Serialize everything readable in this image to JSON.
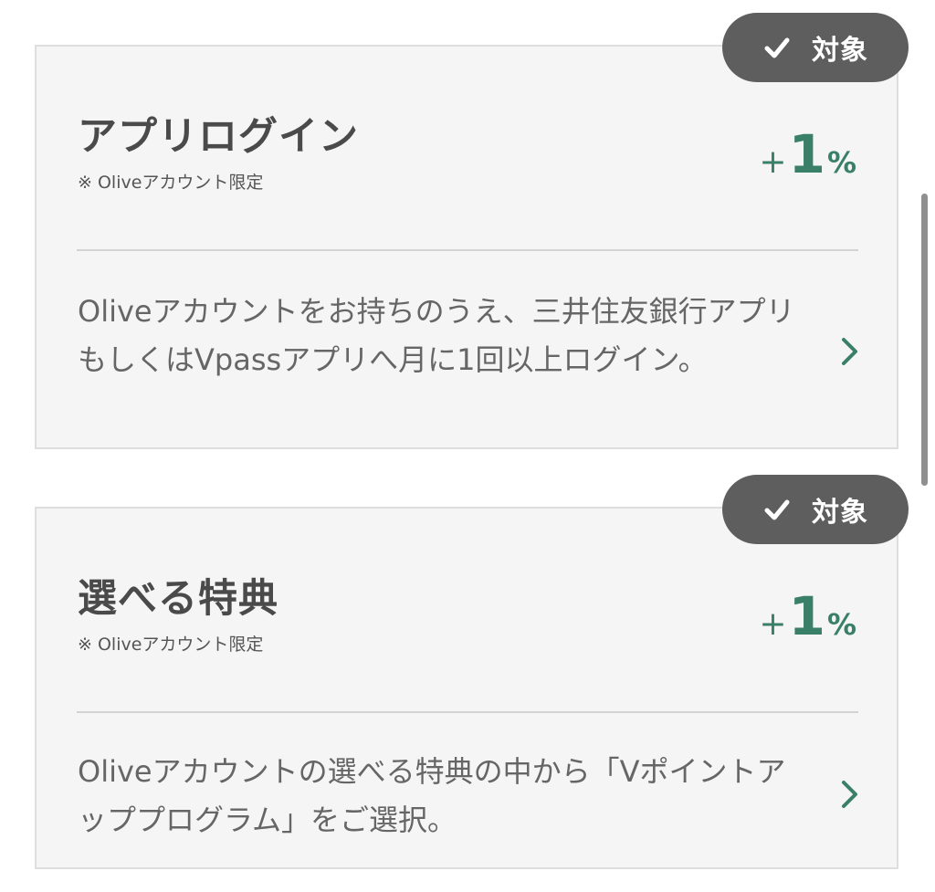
{
  "cards": [
    {
      "badge_label": "対象",
      "badge_icon": "check-icon",
      "title": "アプリログイン",
      "note": "※ Oliveアカウント限定",
      "rate_prefix": "+",
      "rate_value": "1",
      "rate_unit": "%",
      "description": "Oliveアカウントをお持ちのうえ、三井住友銀行アプリもしくはVpassアプリへ月に1回以上ログイン。",
      "link_icon": "chevron-right-icon"
    },
    {
      "badge_label": "対象",
      "badge_icon": "check-icon",
      "title": "選べる特典",
      "note": "※ Oliveアカウント限定",
      "rate_prefix": "+",
      "rate_value": "1",
      "rate_unit": "%",
      "description": "Oliveアカウントの選べる特典の中から「Vポイントアッププログラム」をご選択。",
      "link_icon": "chevron-right-icon"
    }
  ],
  "colors": {
    "accent_green": "#3a7f67",
    "badge_bg": "#5e5e5e",
    "card_bg": "#f5f5f5"
  }
}
